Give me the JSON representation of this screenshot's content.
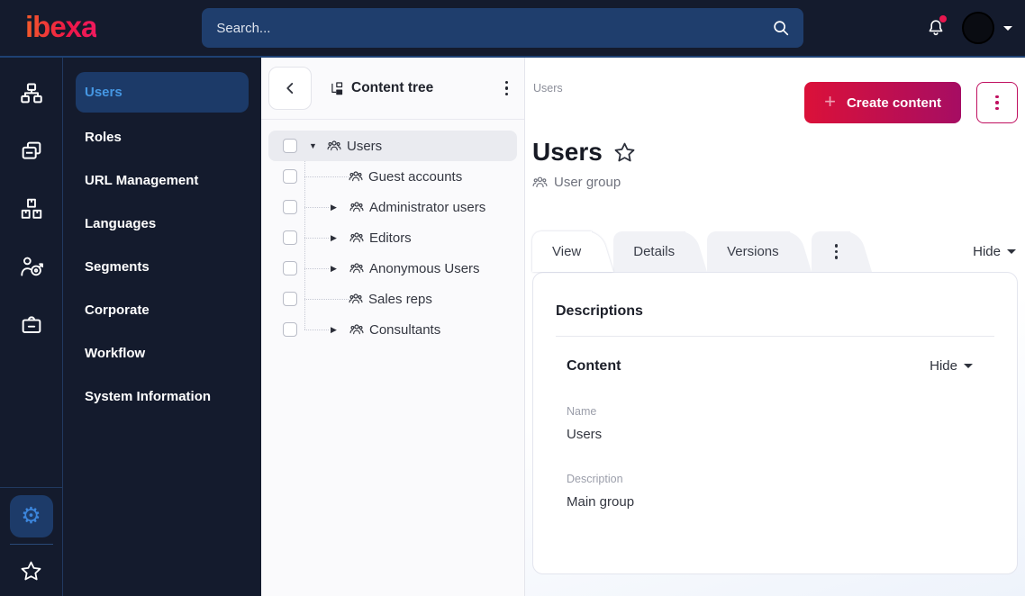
{
  "colors": {
    "dark_navy": "#141b2d",
    "accent_blue": "#4597e3",
    "button_gradient_start": "#db1139",
    "button_gradient_end": "#a60d63",
    "brand_gradient_start": "#f25b2a",
    "brand_gradient_end": "#ef1a5e"
  },
  "topbar": {
    "logo_text": "ibexa",
    "search_placeholder": "Search...",
    "notification_dot": true
  },
  "rail": {
    "icons": [
      "content-structure-icon",
      "content-list-icon",
      "modules-icon",
      "personalization-icon",
      "corporate-icon"
    ],
    "bottom_icons": [
      "settings-gear-icon",
      "bookmarks-star-icon"
    ],
    "active_icon": "settings-gear-icon",
    "gear_glyph": "⚙"
  },
  "sidebar": {
    "items": [
      {
        "label": "Users",
        "active": true
      },
      {
        "label": "Roles",
        "active": false
      },
      {
        "label": "URL Management",
        "active": false
      },
      {
        "label": "Languages",
        "active": false
      },
      {
        "label": "Segments",
        "active": false
      },
      {
        "label": "Corporate",
        "active": false
      },
      {
        "label": "Workflow",
        "active": false
      },
      {
        "label": "System Information",
        "active": false
      }
    ]
  },
  "content_tree": {
    "title": "Content tree",
    "items": [
      {
        "label": "Users",
        "expand": "expanded",
        "selected": true,
        "level": 0
      },
      {
        "label": "Guest accounts",
        "expand": "none",
        "selected": false,
        "level": 1
      },
      {
        "label": "Administrator users",
        "expand": "collapsed",
        "selected": false,
        "level": 1
      },
      {
        "label": "Editors",
        "expand": "collapsed",
        "selected": false,
        "level": 1
      },
      {
        "label": "Anonymous Users",
        "expand": "collapsed",
        "selected": false,
        "level": 1
      },
      {
        "label": "Sales reps",
        "expand": "none",
        "selected": false,
        "level": 1
      },
      {
        "label": "Consultants",
        "expand": "collapsed",
        "selected": false,
        "level": 1
      }
    ]
  },
  "main": {
    "breadcrumb": "Users",
    "create_button_label": "Create content",
    "title": "Users",
    "content_type": "User group",
    "tabs": [
      {
        "label": "View",
        "active": true
      },
      {
        "label": "Details",
        "active": false
      },
      {
        "label": "Versions",
        "active": false
      }
    ],
    "collapse_label": "Hide",
    "card": {
      "heading": "Descriptions",
      "section": {
        "heading": "Content",
        "collapse_label": "Hide",
        "fields": [
          {
            "label": "Name",
            "value": "Users"
          },
          {
            "label": "Description",
            "value": "Main group"
          }
        ]
      }
    }
  }
}
